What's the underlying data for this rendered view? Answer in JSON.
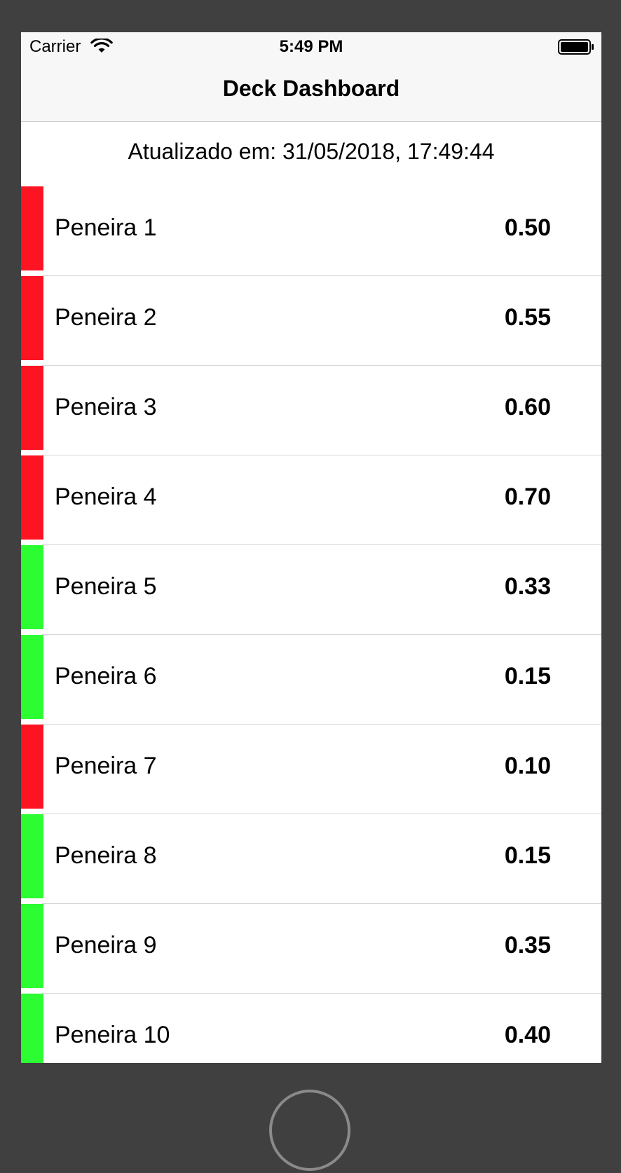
{
  "status_bar": {
    "carrier": "Carrier",
    "time": "5:49 PM",
    "wifi_icon": "wifi-icon",
    "battery_icon": "battery-icon"
  },
  "nav": {
    "title": "Deck Dashboard"
  },
  "updated_label": "Atualizado em: 31/05/2018, 17:49:44",
  "colors": {
    "alert": "#fc1423",
    "ok": "#2cfc32",
    "device_frame": "#404040"
  },
  "rows": [
    {
      "label": "Peneira 1",
      "value": "0.50",
      "status": "red"
    },
    {
      "label": "Peneira 2",
      "value": "0.55",
      "status": "red"
    },
    {
      "label": "Peneira 3",
      "value": "0.60",
      "status": "red"
    },
    {
      "label": "Peneira 4",
      "value": "0.70",
      "status": "red"
    },
    {
      "label": "Peneira 5",
      "value": "0.33",
      "status": "green"
    },
    {
      "label": "Peneira 6",
      "value": "0.15",
      "status": "green"
    },
    {
      "label": "Peneira 7",
      "value": "0.10",
      "status": "red"
    },
    {
      "label": "Peneira 8",
      "value": "0.15",
      "status": "green"
    },
    {
      "label": "Peneira 9",
      "value": "0.35",
      "status": "green"
    },
    {
      "label": "Peneira 10",
      "value": "0.40",
      "status": "green"
    }
  ]
}
